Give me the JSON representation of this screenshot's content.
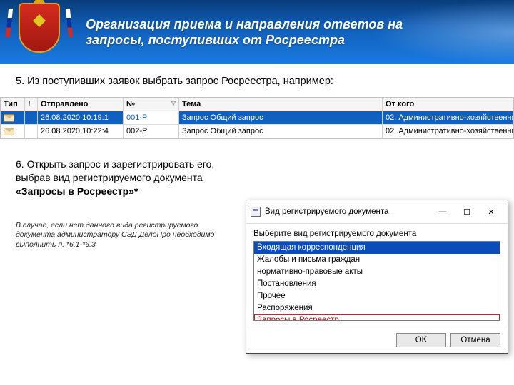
{
  "header": {
    "title": "Организация приема и направления ответов на запросы, поступивших от Росреестра"
  },
  "step5": "5. Из поступивших заявок выбрать запрос Росреестра, например:",
  "grid": {
    "headers": {
      "type": "Тип",
      "flag": "!",
      "sent": "Отправлено",
      "no": "№",
      "subject": "Тема",
      "from": "От кого"
    },
    "rows": [
      {
        "sent": "26.08.2020 10:19:1",
        "no": "001-Р",
        "subject": "Запрос Общий запрос",
        "from": "02. Административно-хозяйственны"
      },
      {
        "sent": "26.08.2020 10:22:4",
        "no": "002-Р",
        "subject": "Запрос Общий запрос",
        "from": "02. Административно-хозяйственны"
      }
    ]
  },
  "step6": {
    "prefix": "6. Открыть запрос и зарегистрировать его, выбрав вид регистрируемого документа ",
    "bold": "«Запросы в Росреестр»*"
  },
  "footnote": "В случае, если нет данного вида регистрируемого документа администратору СЭД ДелоПро необходимо выполнить п. *6.1-*6.3",
  "dialog": {
    "title": "Вид регистрируемого документа",
    "label": "Выберите вид регистрируемого документа",
    "options": [
      "Входящая корреспонденция",
      "Жалобы и письма граждан",
      "нормативно-правовые акты",
      "Постановления",
      "Прочее",
      "Распоряжения",
      "Запросы в Росреестр"
    ],
    "ok": "OK",
    "cancel": "Отмена",
    "btn_min": "—",
    "btn_max": "☐",
    "btn_close": "✕"
  }
}
